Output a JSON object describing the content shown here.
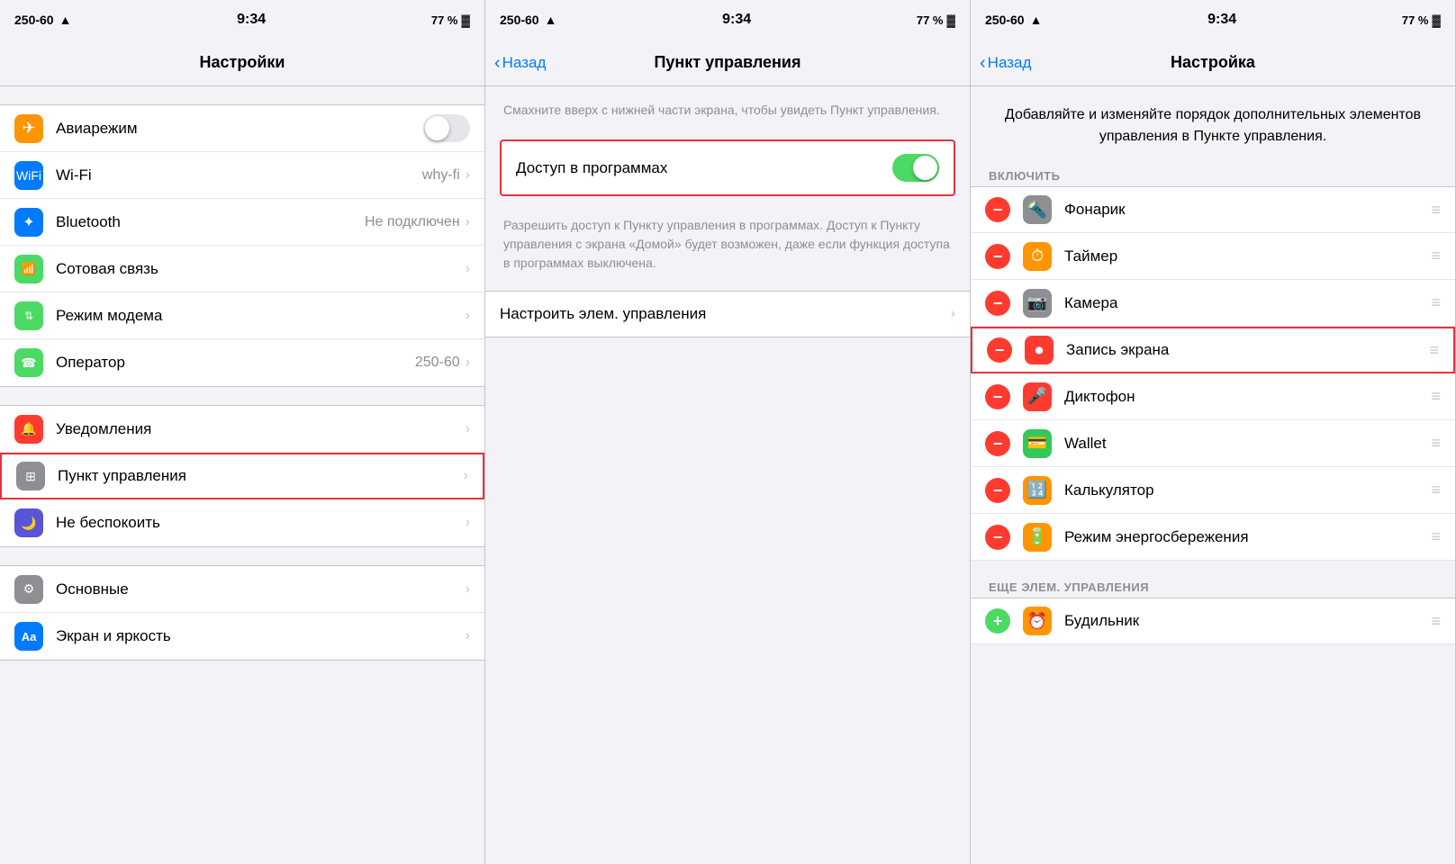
{
  "panels": [
    {
      "id": "settings-main",
      "statusBar": {
        "carrier": "250-60",
        "time": "9:34",
        "battery": "77 %"
      },
      "navTitle": "Настройки",
      "sections": [
        {
          "items": [
            {
              "id": "airplane",
              "iconClass": "icon-airplane",
              "iconSymbol": "✈",
              "label": "Авиарежим",
              "type": "toggle-off",
              "value": ""
            },
            {
              "id": "wifi",
              "iconClass": "icon-wifi",
              "iconSymbol": "📶",
              "label": "Wi-Fi",
              "type": "value-chevron",
              "value": "why-fi"
            },
            {
              "id": "bluetooth",
              "iconClass": "icon-bluetooth",
              "iconSymbol": "🔵",
              "label": "Bluetooth",
              "type": "value-chevron",
              "value": "Не подключен"
            },
            {
              "id": "cellular",
              "iconClass": "icon-cellular",
              "iconSymbol": "📡",
              "label": "Сотовая связь",
              "type": "chevron",
              "value": ""
            },
            {
              "id": "hotspot",
              "iconClass": "icon-hotspot",
              "iconSymbol": "📲",
              "label": "Режим модема",
              "type": "chevron",
              "value": ""
            },
            {
              "id": "operator",
              "iconClass": "icon-phone",
              "iconSymbol": "📞",
              "label": "Оператор",
              "type": "value-chevron",
              "value": "250-60"
            }
          ]
        },
        {
          "items": [
            {
              "id": "notifications",
              "iconClass": "icon-notifications",
              "iconSymbol": "🔔",
              "label": "Уведомления",
              "type": "chevron",
              "value": "",
              "highlighted": false
            },
            {
              "id": "control-center",
              "iconClass": "icon-control",
              "iconSymbol": "⚙",
              "label": "Пункт управления",
              "type": "chevron",
              "value": "",
              "highlighted": true
            },
            {
              "id": "donotdisturb",
              "iconClass": "icon-donotdisturb",
              "iconSymbol": "🌙",
              "label": "Не беспокоить",
              "type": "chevron",
              "value": "",
              "highlighted": false
            }
          ]
        },
        {
          "items": [
            {
              "id": "general",
              "iconClass": "icon-general",
              "iconSymbol": "⚙",
              "label": "Основные",
              "type": "chevron",
              "value": ""
            },
            {
              "id": "display",
              "iconClass": "icon-display",
              "iconSymbol": "Aa",
              "label": "Экран и яркость",
              "type": "chevron",
              "value": ""
            }
          ]
        }
      ]
    },
    {
      "id": "control-center",
      "statusBar": {
        "carrier": "250-60",
        "time": "9:34",
        "battery": "77 %"
      },
      "navTitle": "Пункт управления",
      "backLabel": "Назад",
      "topDescription": "Смахните вверх с нижней части экрана, чтобы увидеть Пункт управления.",
      "accessToggleLabel": "Доступ в программах",
      "accessToggleOn": true,
      "accessDescription": "Разрешить доступ к Пункту управления в программах. Доступ к Пункту управления с экрана «Домой» будет возможен, даже если функция доступа в программах выключена.",
      "customizeLabel": "Настроить элем. управления"
    },
    {
      "id": "customize",
      "statusBar": {
        "carrier": "250-60",
        "time": "9:34",
        "battery": "77 %"
      },
      "navTitle": "Настройка",
      "backLabel": "Назад",
      "setupDescription": "Добавляйте и изменяйте порядок дополнительных элементов управления в Пункте управления.",
      "includeSectionLabel": "ВКЛЮЧИТЬ",
      "includeItems": [
        {
          "id": "flashlight",
          "label": "Фонарик",
          "iconColor": "#8e8e93",
          "iconSymbol": "🔦"
        },
        {
          "id": "timer",
          "label": "Таймер",
          "iconColor": "#ff9500",
          "iconSymbol": "⏱"
        },
        {
          "id": "camera",
          "label": "Камера",
          "iconColor": "#8e8e93",
          "iconSymbol": "📷"
        },
        {
          "id": "screen-record",
          "label": "Запись экрана",
          "iconColor": "#ff3b30",
          "iconSymbol": "⏺",
          "highlighted": true
        },
        {
          "id": "voice-memo",
          "label": "Диктофон",
          "iconColor": "#ff3b30",
          "iconSymbol": "🎤"
        },
        {
          "id": "wallet",
          "label": "Wallet",
          "iconColor": "#34c759",
          "iconSymbol": "💳"
        },
        {
          "id": "calculator",
          "label": "Калькулятор",
          "iconColor": "#ff9500",
          "iconSymbol": "🔢"
        },
        {
          "id": "power-save",
          "label": "Режим энергосбережения",
          "iconColor": "#ff9500",
          "iconSymbol": "🔋"
        }
      ],
      "moreSectionLabel": "ЕЩЕ ЭЛЕМ. УПРАВЛЕНИЯ",
      "moreItems": [
        {
          "id": "alarm",
          "label": "Будильник",
          "iconColor": "#ff9500",
          "iconSymbol": "⏰"
        }
      ]
    }
  ]
}
